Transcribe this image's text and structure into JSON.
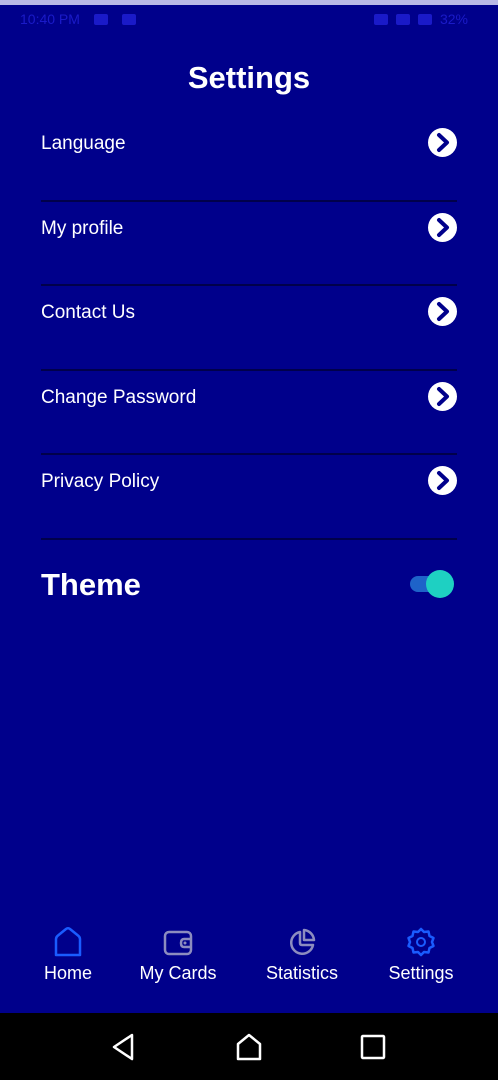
{
  "status_bar": {
    "time": "10:40 PM",
    "battery": "32%"
  },
  "header": {
    "title": "Settings"
  },
  "settings": {
    "items": [
      {
        "label": "Language"
      },
      {
        "label": "My profile"
      },
      {
        "label": "Contact Us"
      },
      {
        "label": "Change Password"
      },
      {
        "label": "Privacy Policy"
      }
    ],
    "theme": {
      "label": "Theme",
      "enabled": true
    }
  },
  "bottom_nav": {
    "items": [
      {
        "label": "Home",
        "icon": "home-icon",
        "active": true
      },
      {
        "label": "My Cards",
        "icon": "wallet-icon",
        "active": false
      },
      {
        "label": "Statistics",
        "icon": "pie-chart-icon",
        "active": false
      },
      {
        "label": "Settings",
        "icon": "gear-icon",
        "active": false
      }
    ]
  },
  "colors": {
    "background": "#00008b",
    "text": "#ffffff",
    "active_nav_icon": "#1a5cff",
    "inactive_nav_icon": "#8c8cbf",
    "toggle_thumb": "#1ed0c2",
    "toggle_track": "#1e63c9"
  }
}
